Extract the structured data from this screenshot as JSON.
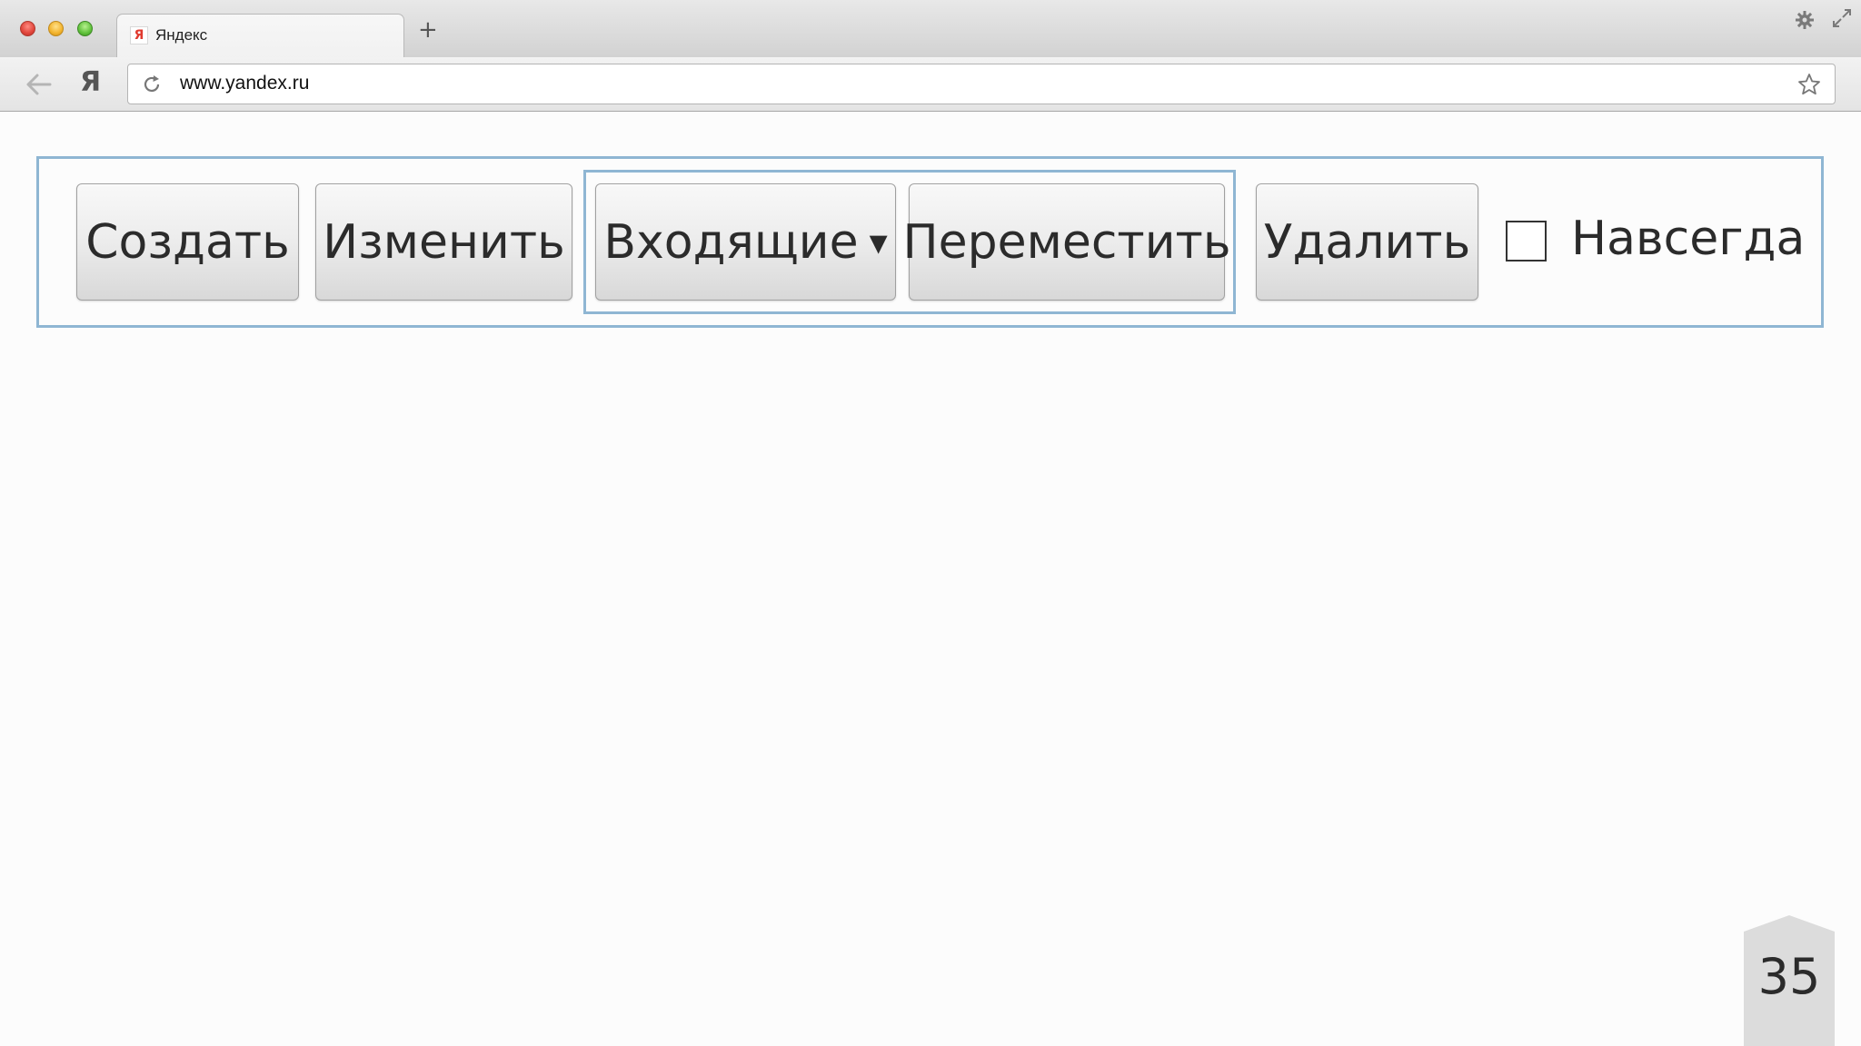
{
  "browser": {
    "tab": {
      "title": "Яндекс",
      "favicon_letter": "Я"
    },
    "new_tab_label": "+",
    "toolbar": {
      "yandex_label": "Я",
      "url": "www.yandex.ru"
    }
  },
  "toolbar": {
    "create_label": "Создать",
    "edit_label": "Изменить",
    "inbox_label": "Входящие",
    "inbox_caret": "▾",
    "move_label": "Переместить",
    "delete_label": "Удалить",
    "forever_label": "Навсегда",
    "forever_checked": false
  },
  "slide": {
    "page_number": "35"
  },
  "colors": {
    "frame": "#8fb6d3",
    "button_top": "#f8f8f8",
    "button_bottom": "#d8d8d8"
  },
  "icons": [
    "back-arrow-icon",
    "reload-icon",
    "star-icon",
    "gear-icon",
    "fullscreen-icon"
  ]
}
